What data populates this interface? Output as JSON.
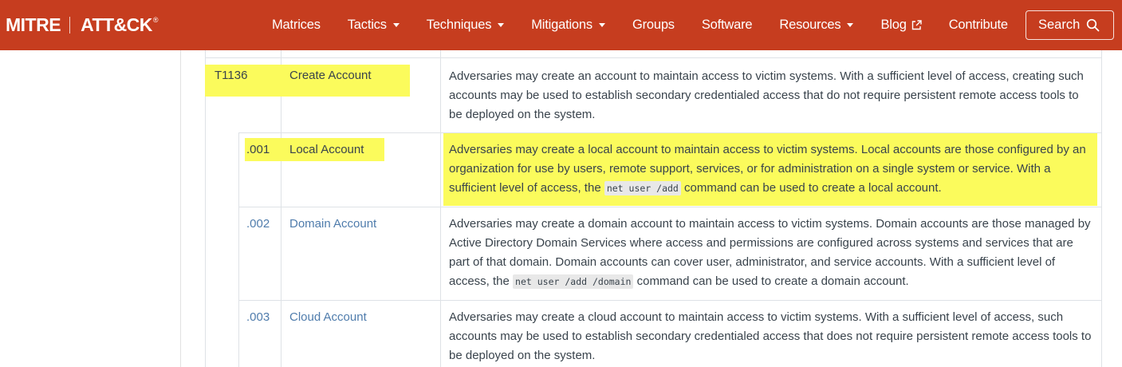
{
  "brand": {
    "mitre": "MITRE",
    "attck": "ATT&CK",
    "reg": "®"
  },
  "nav": {
    "items": [
      {
        "label": "Matrices",
        "dropdown": false
      },
      {
        "label": "Tactics",
        "dropdown": true
      },
      {
        "label": "Techniques",
        "dropdown": true
      },
      {
        "label": "Mitigations",
        "dropdown": true
      },
      {
        "label": "Groups",
        "dropdown": false
      },
      {
        "label": "Software",
        "dropdown": false
      },
      {
        "label": "Resources",
        "dropdown": true
      },
      {
        "label": "Blog",
        "dropdown": false,
        "external": true
      },
      {
        "label": "Contribute",
        "dropdown": false
      }
    ],
    "search_label": "Search"
  },
  "technique": {
    "id": "T1136",
    "name": "Create Account",
    "description": "Adversaries may create an account to maintain access to victim systems. With a sufficient level of access, creating such accounts may be used to establish secondary credentialed access that do not require persistent remote access tools to be deployed on the system."
  },
  "subtechniques": [
    {
      "id": ".001",
      "name": "Local Account",
      "desc_before": "Adversaries may create a local account to maintain access to victim systems. Local accounts are those configured by an organization for use by users, remote support, services, or for administration on a single system or service. With a sufficient level of access, the ",
      "code": "net user /add",
      "desc_after": " command can be used to create a local account."
    },
    {
      "id": ".002",
      "name": "Domain Account",
      "desc_before": "Adversaries may create a domain account to maintain access to victim systems. Domain accounts are those managed by Active Directory Domain Services where access and permissions are configured across systems and services that are part of that domain. Domain accounts can cover user, administrator, and service accounts. With a sufficient level of access, the ",
      "code": "net user /add /domain",
      "desc_after": " command can be used to create a domain account."
    },
    {
      "id": ".003",
      "name": "Cloud Account",
      "desc_before": "Adversaries may create a cloud account to maintain access to victim systems. With a sufficient level of access, such accounts may be used to establish secondary credentialed access that does not require persistent remote access tools to be deployed on the system.",
      "code": "",
      "desc_after": ""
    }
  ],
  "colors": {
    "navbar": "#c63d1f",
    "highlight": "#fbfb5c",
    "link": "#4f7cac",
    "text": "#39434c"
  }
}
